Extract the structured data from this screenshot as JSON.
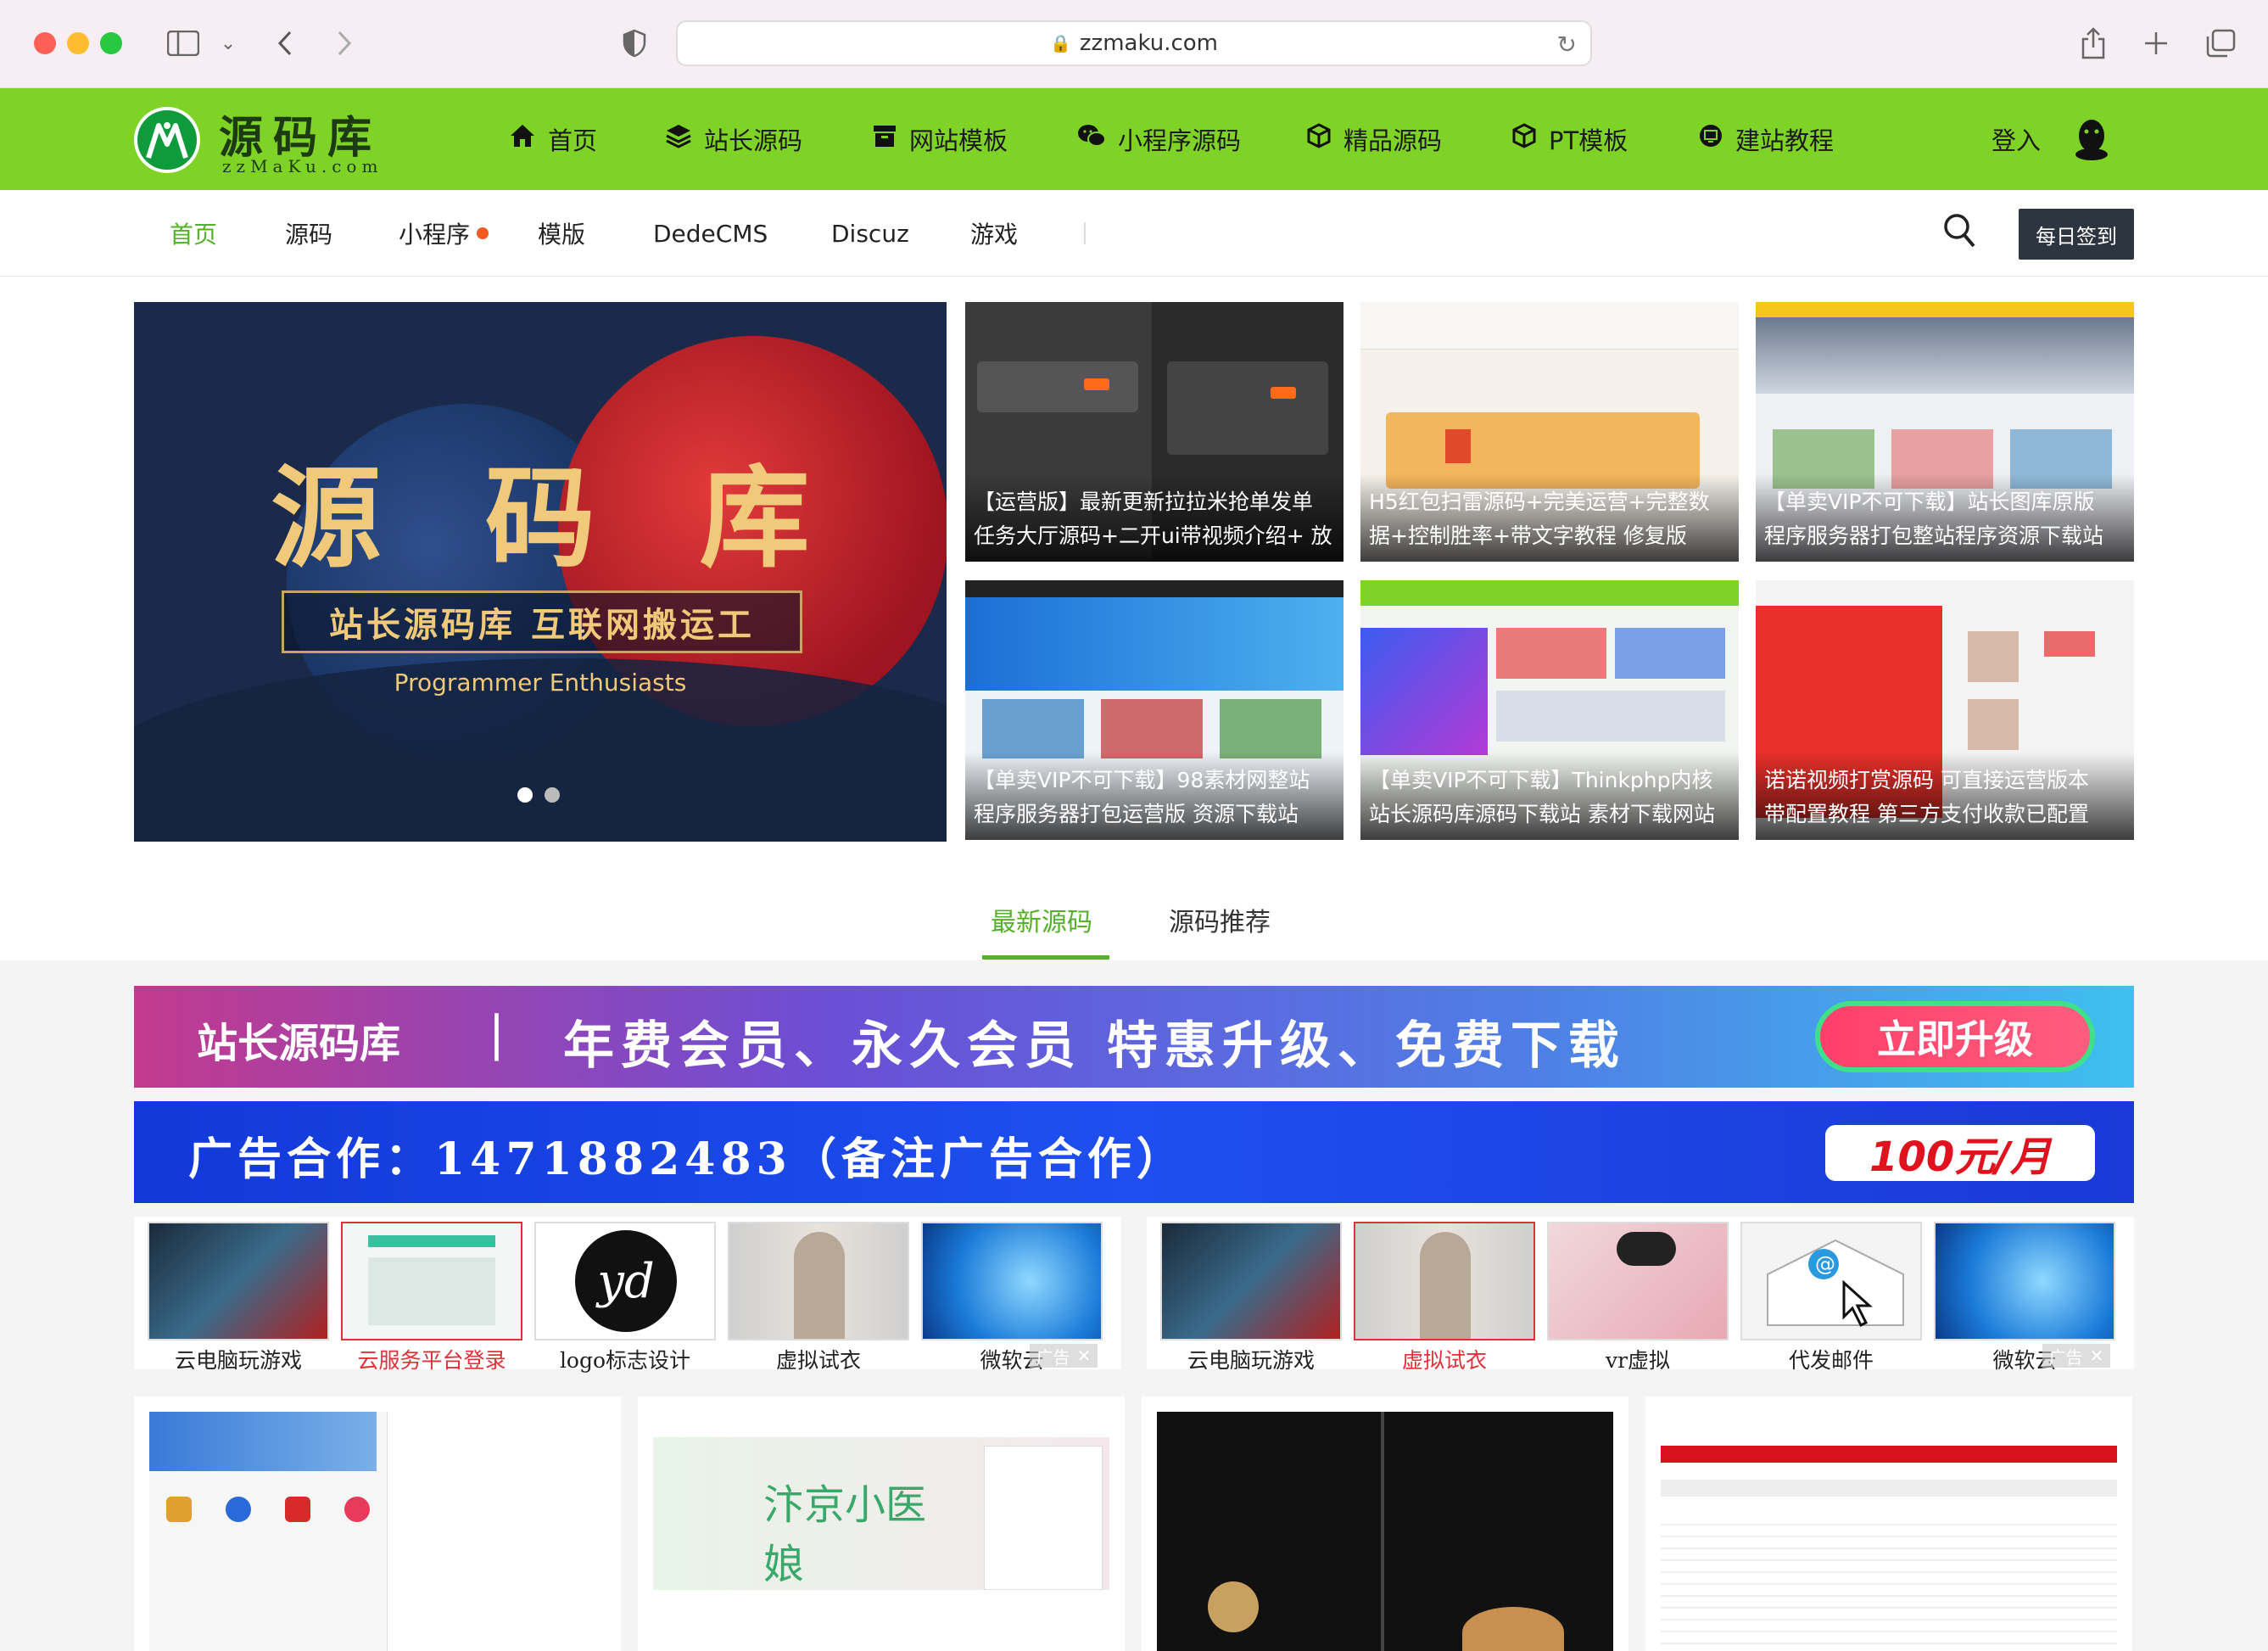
{
  "browser": {
    "url": "zzmaku.com"
  },
  "site": {
    "logo_name": "源码库",
    "logo_domain": "zzMaKu.com"
  },
  "main_nav": [
    {
      "label": "首页",
      "icon": "home-icon"
    },
    {
      "label": "站长源码",
      "icon": "layers-icon"
    },
    {
      "label": "网站模板",
      "icon": "box-icon"
    },
    {
      "label": "小程序源码",
      "icon": "wechat-icon"
    },
    {
      "label": "精品源码",
      "icon": "cube-icon"
    },
    {
      "label": "PT模板",
      "icon": "cube-icon"
    },
    {
      "label": "建站教程",
      "icon": "monitor-icon"
    }
  ],
  "login": {
    "label": "登入"
  },
  "sub_nav": [
    {
      "label": "首页",
      "active": true
    },
    {
      "label": "源码"
    },
    {
      "label": "小程序",
      "badge": true
    },
    {
      "label": "模版"
    },
    {
      "label": "DedeCMS"
    },
    {
      "label": "Discuz"
    },
    {
      "label": "游戏"
    }
  ],
  "signin": {
    "label": "每日签到"
  },
  "hero": {
    "chars": [
      "源",
      "码",
      "库"
    ],
    "ribbon": "站长源码库 互联网搬运工",
    "subtitle": "Programmer Enthusiasts"
  },
  "tiles": [
    {
      "line1": "【运营版】最新更新拉拉米抢单发单",
      "line2": "任务大厅源码+二开ui带视频介绍+ 放"
    },
    {
      "line1": "H5红包扫雷源码+完美运营+完整数",
      "line2": "据+控制胜率+带文字教程 修复版"
    },
    {
      "line1": "【单卖VIP不可下载】站长图库原版",
      "line2": "程序服务器打包整站程序资源下载站"
    },
    {
      "line1": "【单卖VIP不可下载】98素材网整站",
      "line2": "程序服务器打包运营版 资源下载站"
    },
    {
      "line1": "【单卖VIP不可下载】Thinkphp内核",
      "line2": "站长源码库源码下载站 素材下载网站"
    },
    {
      "line1": "诺诺视频打赏源码 可直接运营版本",
      "line2": "带配置教程 第三方支付收款已配置"
    }
  ],
  "tabs": [
    {
      "label": "最新源码",
      "active": true
    },
    {
      "label": "源码推荐"
    }
  ],
  "banner1": {
    "left": "站长源码库",
    "sep": "|",
    "main": "年费会员、永久会员 特惠升级、免费下载",
    "cta": "立即升级"
  },
  "banner2": {
    "text": "广告合作：1471882483（备注广告合作）",
    "price": "100元/月"
  },
  "ads_left": [
    {
      "label": "云电脑玩游戏"
    },
    {
      "label": "云服务平台登录",
      "highlight": true
    },
    {
      "label": "logo标志设计"
    },
    {
      "label": "虚拟试衣"
    },
    {
      "label": "微软云"
    }
  ],
  "ads_right": [
    {
      "label": "云电脑玩游戏"
    },
    {
      "label": "虚拟试衣",
      "highlight": true
    },
    {
      "label": "vr虚拟"
    },
    {
      "label": "代发邮件"
    },
    {
      "label": "微软云"
    }
  ],
  "ad_tag": "广告",
  "colors": {
    "brand_green": "#7fd327",
    "active_green": "#55b02a",
    "accent_red": "#e0303a"
  }
}
